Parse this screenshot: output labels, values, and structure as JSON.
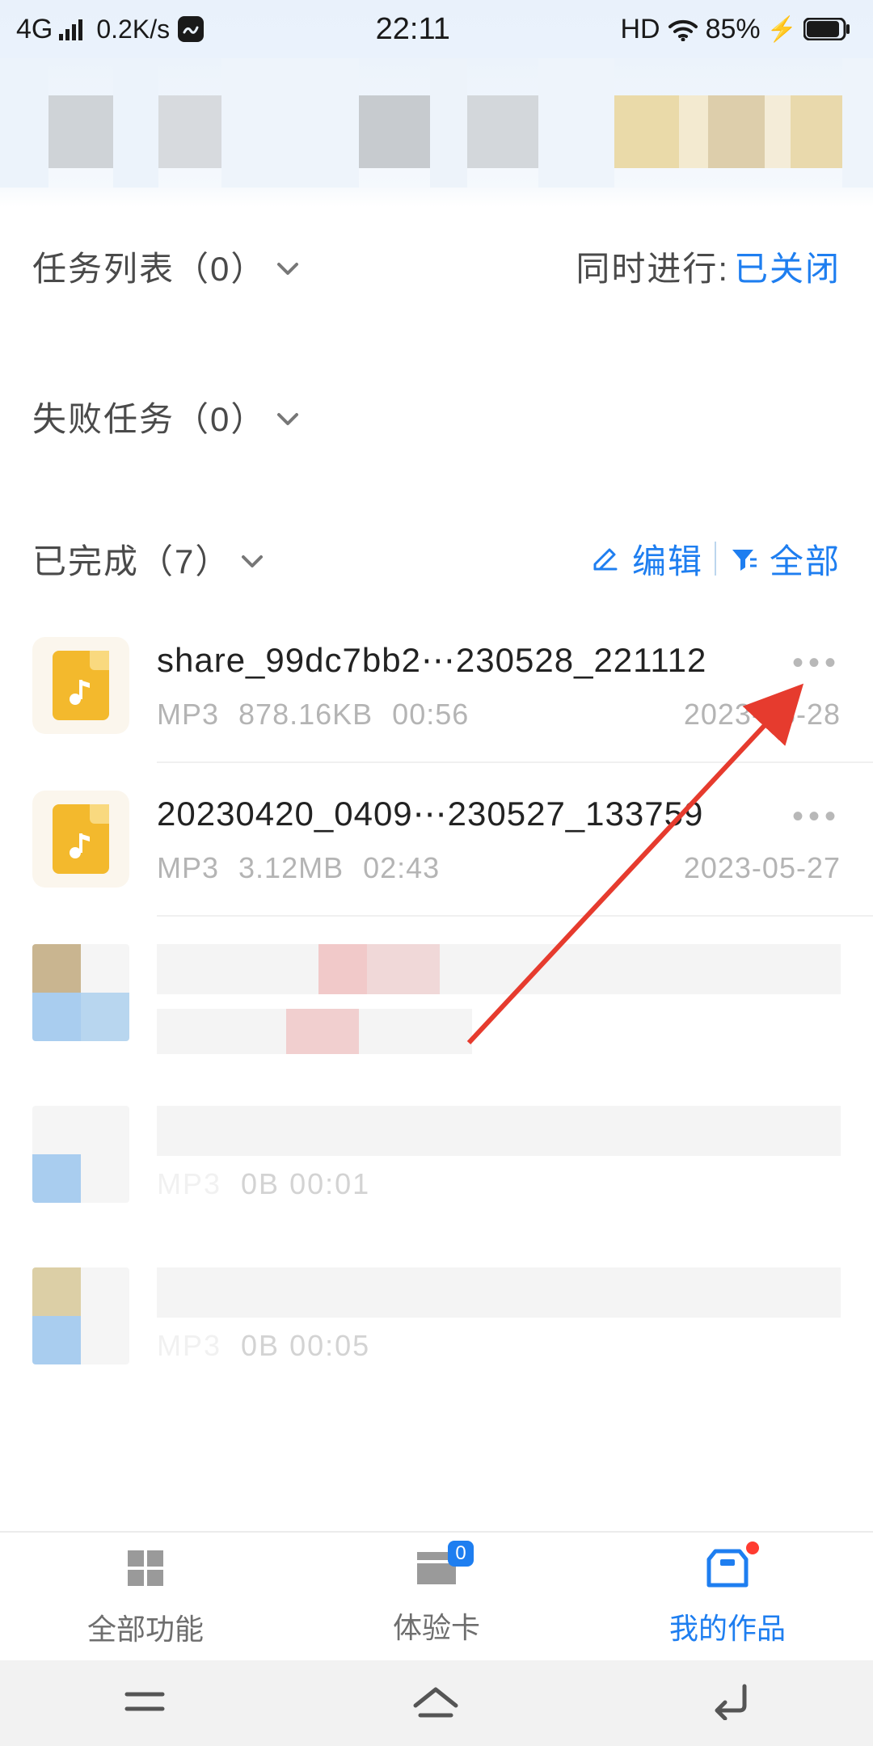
{
  "status": {
    "network": "4G",
    "speed": "0.2K/s",
    "time": "22:11",
    "hd": "HD",
    "battery": "85%"
  },
  "sections": {
    "task_list_label": "任务列表（0）",
    "concurrent_label": "同时进行:",
    "concurrent_value": "已关闭",
    "failed_label": "失败任务（0）",
    "done_label": "已完成（7）",
    "edit_label": "编辑",
    "filter_label": "全部"
  },
  "files": [
    {
      "name": "share_99dc7bb2⋯230528_221112",
      "type": "MP3",
      "size": "878.16KB",
      "duration": "00:56",
      "date": "2023-05-28"
    },
    {
      "name": "20230420_0409⋯230527_133759",
      "type": "MP3",
      "size": "3.12MB",
      "duration": "02:43",
      "date": "2023-05-27"
    }
  ],
  "blurred_meta": {
    "row4": "0B  00:01",
    "row5": "0B  00:05"
  },
  "tabs": {
    "all": "全部功能",
    "card": "体验卡",
    "card_badge": "0",
    "mine": "我的作品"
  }
}
